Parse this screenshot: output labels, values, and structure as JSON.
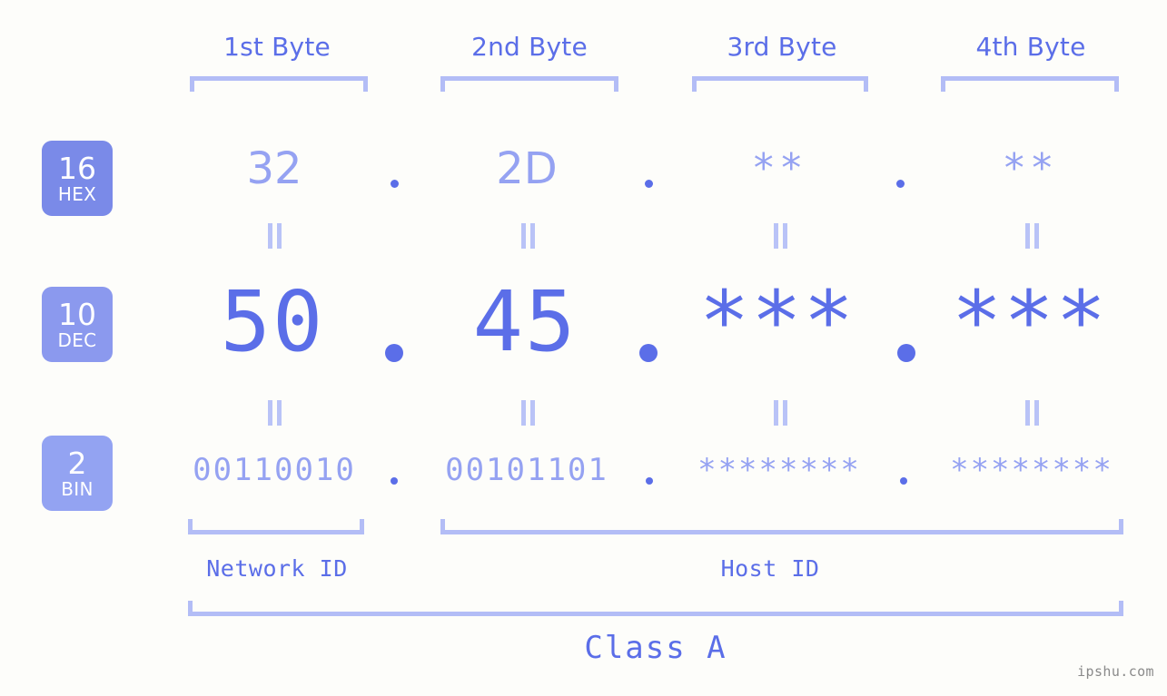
{
  "background_color": "#fdfdfa",
  "accent_color": "#5b6ee8",
  "muted_accent_color": "#95a2f2",
  "bracket_color": "#b3bdf6",
  "headers": {
    "byte1": "1st Byte",
    "byte2": "2nd Byte",
    "byte3": "3rd Byte",
    "byte4": "4th Byte"
  },
  "radix": [
    {
      "number": "16",
      "name": "HEX",
      "color": "#7a8ae8"
    },
    {
      "number": "10",
      "name": "DEC",
      "color": "#8b99ee"
    },
    {
      "number": "2",
      "name": "BIN",
      "color": "#93a3f2"
    }
  ],
  "rows": {
    "hex": {
      "label": "HEX",
      "values": [
        "32",
        "2D",
        "**",
        "**"
      ],
      "separator": "."
    },
    "dec": {
      "label": "DEC",
      "values": [
        "50",
        "45",
        "***",
        "***"
      ],
      "separator": "."
    },
    "bin": {
      "label": "BIN",
      "values": [
        "00110010",
        "00101101",
        "********",
        "********"
      ],
      "separator": "."
    }
  },
  "equals_marker": "=",
  "footer": {
    "network_id_label": "Network ID",
    "host_id_label": "Host ID",
    "class_label": "Class A"
  },
  "watermark": "ipshu.com"
}
